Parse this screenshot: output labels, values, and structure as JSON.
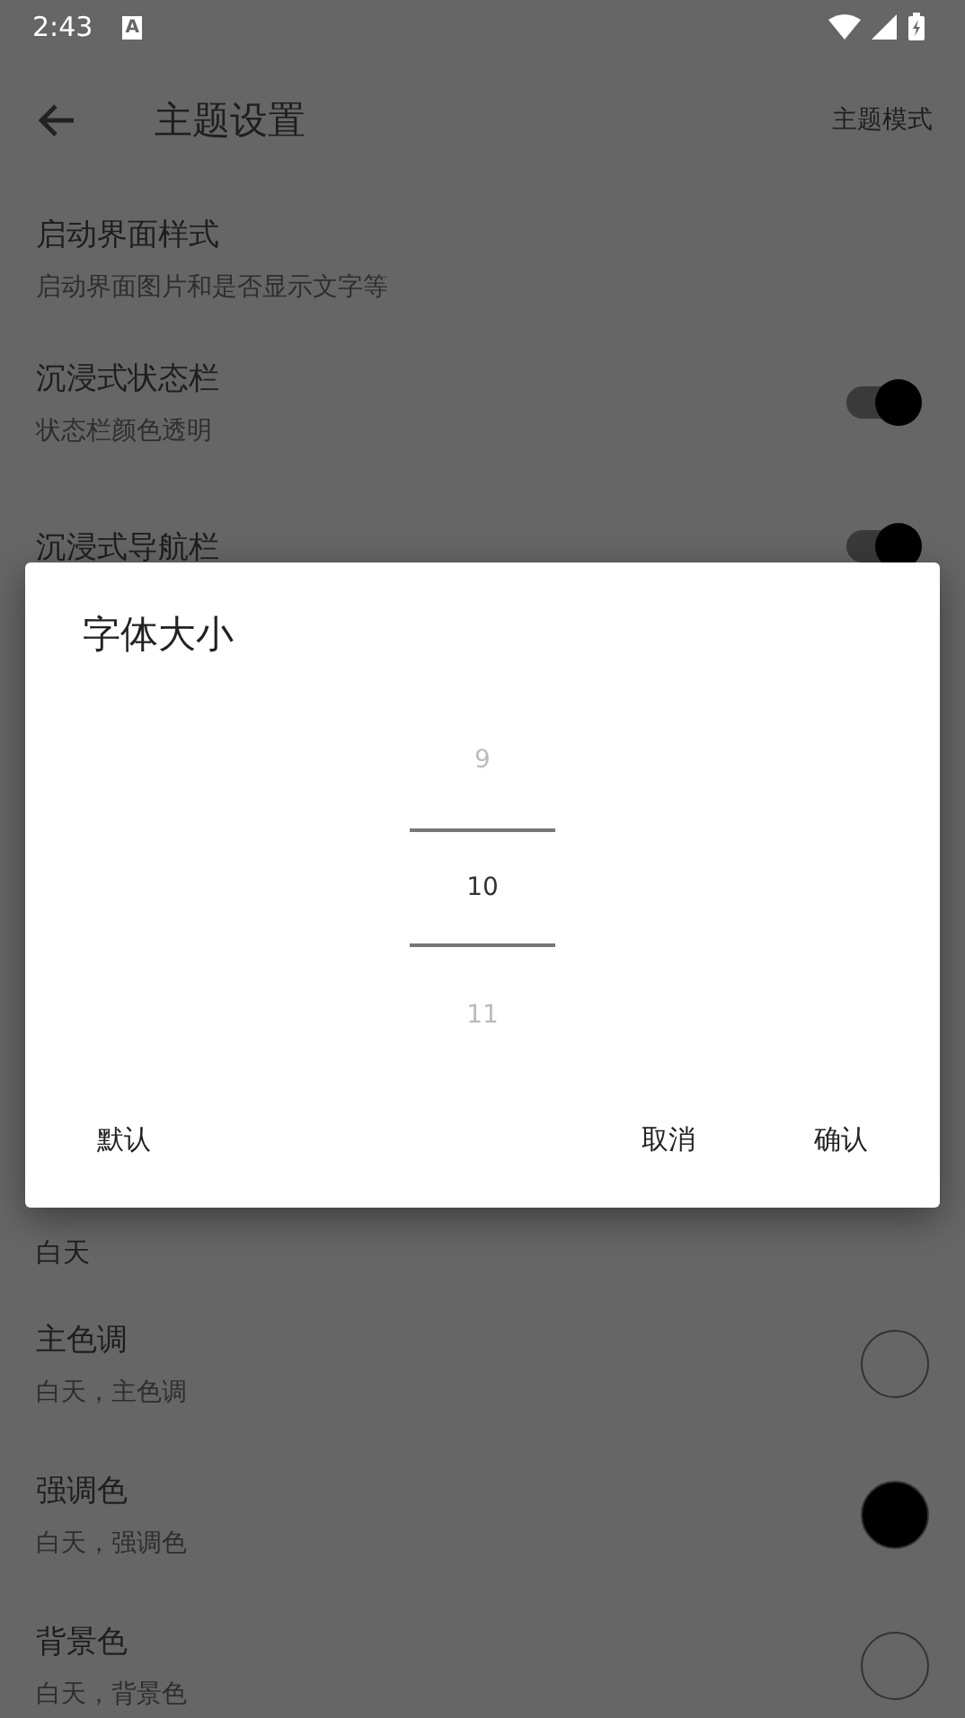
{
  "status_bar": {
    "time": "2:43",
    "notification": "A"
  },
  "toolbar": {
    "title": "主题设置",
    "action": "主题模式"
  },
  "settings": [
    {
      "kind": "link",
      "title": "启动界面样式",
      "subtitle": "启动界面图片和是否显示文字等"
    },
    {
      "kind": "switch",
      "title": "沉浸式状态栏",
      "subtitle": "状态栏颜色透明",
      "on": true
    },
    {
      "kind": "switch",
      "title": "沉浸式导航栏",
      "on": true
    }
  ],
  "section": {
    "header": "白天",
    "items": [
      {
        "title": "主色调",
        "subtitle": "白天，主色调",
        "color": "#666666"
      },
      {
        "title": "强调色",
        "subtitle": "白天，强调色",
        "color": "#000000"
      },
      {
        "title": "背景色",
        "subtitle": "白天，背景色",
        "color": "#666666"
      }
    ]
  },
  "dialog": {
    "title": "字体大小",
    "picker": [
      {
        "label": "9",
        "selected": false
      },
      {
        "label": "10",
        "selected": true
      },
      {
        "label": "11",
        "selected": false
      }
    ],
    "buttons": [
      {
        "label": "默认"
      },
      {
        "label": "取消"
      },
      {
        "label": "确认"
      }
    ]
  }
}
